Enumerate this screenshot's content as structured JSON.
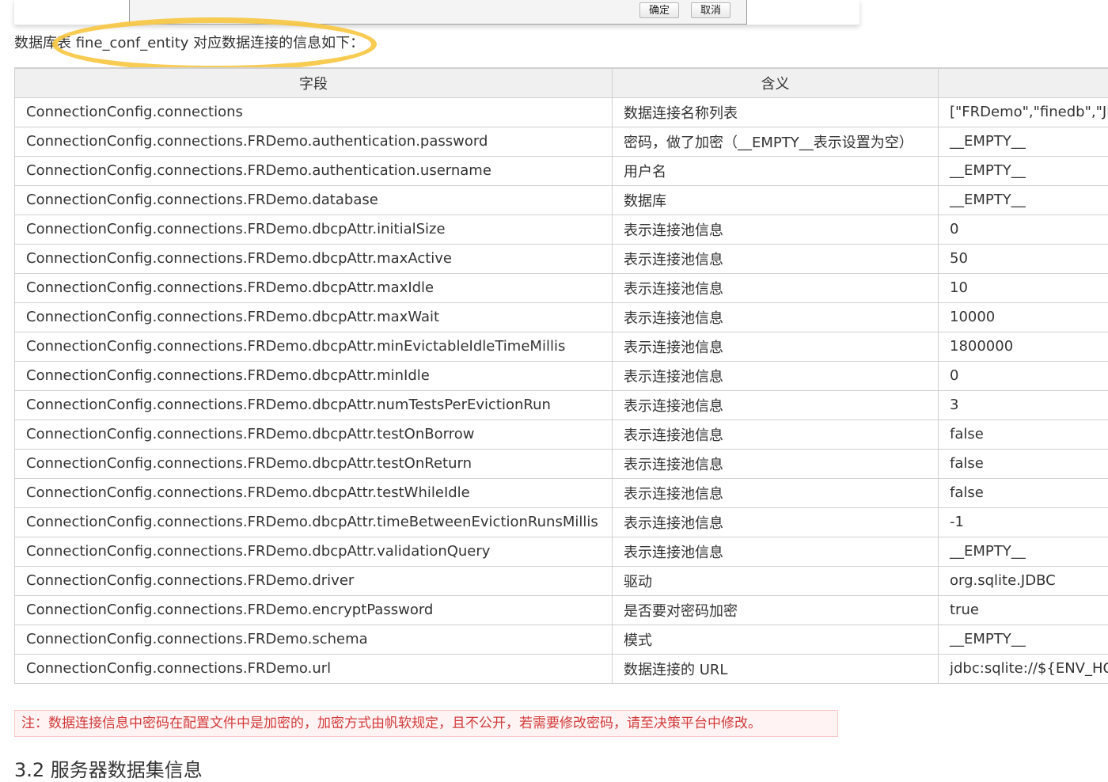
{
  "dialog": {
    "ok_label": "确定",
    "cancel_label": "取消"
  },
  "intro": {
    "text": "数据库表 fine_conf_entity 对应数据连接的信息如下："
  },
  "table": {
    "headers": [
      "字段",
      "含义",
      ""
    ],
    "rows": [
      [
        "ConnectionConfig.connections",
        " 数据连接名称列表",
        "[\"FRDemo\",\"finedb\",\"JDBC\"]"
      ],
      [
        "ConnectionConfig.connections.FRDemo.authentication.password",
        "密码，做了加密（__EMPTY__表示设置为空）",
        "__EMPTY__"
      ],
      [
        "ConnectionConfig.connections.FRDemo.authentication.username",
        "用户名",
        "__EMPTY__"
      ],
      [
        "ConnectionConfig.connections.FRDemo.database",
        "数据库",
        "__EMPTY__"
      ],
      [
        "ConnectionConfig.connections.FRDemo.dbcpAttr.initialSize",
        "表示连接池信息",
        "0"
      ],
      [
        "ConnectionConfig.connections.FRDemo.dbcpAttr.maxActive",
        "表示连接池信息",
        "50"
      ],
      [
        "ConnectionConfig.connections.FRDemo.dbcpAttr.maxIdle",
        "表示连接池信息",
        "10"
      ],
      [
        "ConnectionConfig.connections.FRDemo.dbcpAttr.maxWait",
        "表示连接池信息",
        "10000"
      ],
      [
        "ConnectionConfig.connections.FRDemo.dbcpAttr.minEvictableIdleTimeMillis",
        "表示连接池信息",
        "1800000"
      ],
      [
        "ConnectionConfig.connections.FRDemo.dbcpAttr.minIdle",
        "表示连接池信息",
        "0"
      ],
      [
        "ConnectionConfig.connections.FRDemo.dbcpAttr.numTestsPerEvictionRun",
        "表示连接池信息",
        "3"
      ],
      [
        "ConnectionConfig.connections.FRDemo.dbcpAttr.testOnBorrow",
        "表示连接池信息",
        "false"
      ],
      [
        "ConnectionConfig.connections.FRDemo.dbcpAttr.testOnReturn",
        "表示连接池信息",
        "false"
      ],
      [
        "ConnectionConfig.connections.FRDemo.dbcpAttr.testWhileIdle",
        "表示连接池信息",
        "false"
      ],
      [
        "ConnectionConfig.connections.FRDemo.dbcpAttr.timeBetweenEvictionRunsMillis",
        "表示连接池信息",
        "-1"
      ],
      [
        "ConnectionConfig.connections.FRDemo.dbcpAttr.validationQuery",
        "表示连接池信息",
        "__EMPTY__"
      ],
      [
        "ConnectionConfig.connections.FRDemo.driver",
        "驱动",
        "org.sqlite.JDBC"
      ],
      [
        "ConnectionConfig.connections.FRDemo.encryptPassword",
        "是否要对密码加密",
        "true"
      ],
      [
        "ConnectionConfig.connections.FRDemo.schema",
        "模式",
        "__EMPTY__"
      ],
      [
        "ConnectionConfig.connections.FRDemo.url",
        "数据连接的 URL",
        "jdbc:sqlite://${ENV_HOME}"
      ]
    ]
  },
  "note": {
    "text": "注：数据连接信息中密码在配置文件中是加密的，加密方式由帆软规定，且不公开，若需要修改密码，请至决策平台中修改。"
  },
  "next_section": {
    "title": "3.2 服务器数据集信息"
  },
  "colors": {
    "highlight_ellipse": "#f7c640",
    "note_text": "#d33b3b",
    "note_background": "#fff3f3",
    "table_border": "#d0d0d0",
    "header_background": "#f0f0f0"
  }
}
